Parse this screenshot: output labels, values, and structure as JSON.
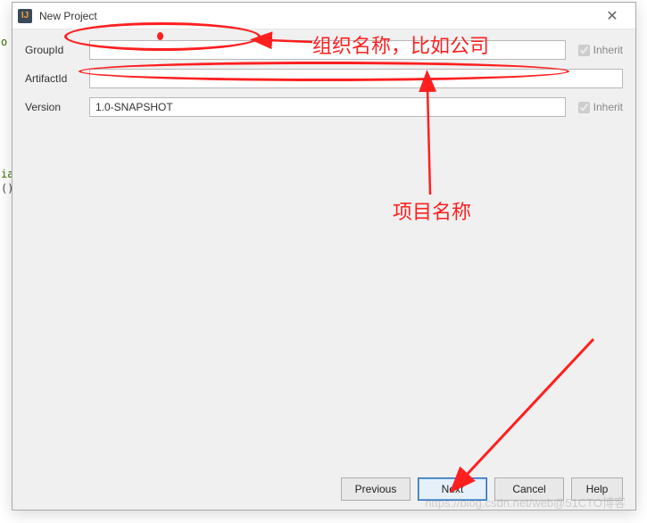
{
  "window": {
    "title": "New Project",
    "icon_text": "IJ"
  },
  "fields": {
    "groupId": {
      "label": "GroupId",
      "value": "",
      "inherit_label": "Inherit",
      "inherit_checked": true
    },
    "artifactId": {
      "label": "ArtifactId",
      "value": ""
    },
    "version": {
      "label": "Version",
      "value": "1.0-SNAPSHOT",
      "inherit_label": "Inherit",
      "inherit_checked": true
    }
  },
  "buttons": {
    "previous": "Previous",
    "next": "Next",
    "cancel": "Cancel",
    "help": "Help"
  },
  "annotations": {
    "org_name": "组织名称，比如公司",
    "project_name": "项目名称"
  },
  "watermark": "https://blog.csdn.net/web@51CTO博客",
  "bg": {
    "ia": "ia",
    "parens": "()"
  }
}
